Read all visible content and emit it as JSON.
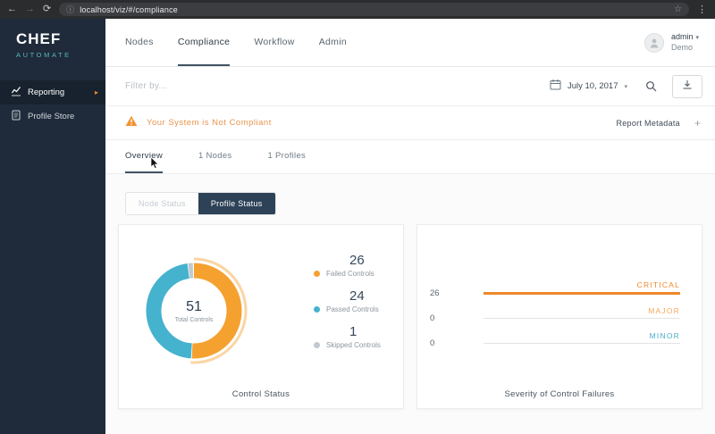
{
  "browser": {
    "url": "localhost/viz/#/compliance",
    "back_icon": "←",
    "forward_icon": "→",
    "reload_icon": "⟳",
    "info_icon": "ⓘ",
    "star_icon": "☆",
    "menu_icon": "⋮"
  },
  "sidebar": {
    "logo": {
      "line1": "CHEF",
      "line2": "AUTOMATE"
    },
    "active_arrow": "▸",
    "items": [
      {
        "label": "Reporting",
        "active": true
      },
      {
        "label": "Profile Store",
        "active": false
      }
    ]
  },
  "topnav": {
    "items": [
      {
        "label": "Nodes",
        "active": false
      },
      {
        "label": "Compliance",
        "active": true
      },
      {
        "label": "Workflow",
        "active": false
      },
      {
        "label": "Admin",
        "active": false
      }
    ],
    "user": {
      "name": "admin",
      "org": "Demo",
      "caret": "▾"
    }
  },
  "filter_bar": {
    "placeholder": "Filter by...",
    "date": "July 10, 2017",
    "caret": "▾"
  },
  "banner": {
    "message": "Your System is Not Compliant",
    "metadata_label": "Report Metadata",
    "metadata_action": "+"
  },
  "tabs": [
    {
      "label": "Overview",
      "active": true
    },
    {
      "label": "1 Nodes",
      "active": false
    },
    {
      "label": "1 Profiles",
      "active": false
    }
  ],
  "status_toggle": [
    {
      "label": "Node Status",
      "active": false
    },
    {
      "label": "Profile Status",
      "active": true
    }
  ],
  "chart_data": [
    {
      "type": "pie",
      "title": "Control Status",
      "center_value": "51",
      "center_label": "Total Controls",
      "segments": [
        {
          "name": "Failed Controls",
          "value": 26,
          "color": "#f5a130"
        },
        {
          "name": "Passed Controls",
          "value": 24,
          "color": "#45b2ce"
        },
        {
          "name": "Skipped Controls",
          "value": 1,
          "color": "#c3c9ce"
        }
      ]
    },
    {
      "type": "bar",
      "orientation": "horizontal",
      "title": "Severity of Control Failures",
      "categories": [
        "CRITICAL",
        "MAJOR",
        "MINOR"
      ],
      "values": [
        26,
        0,
        0
      ],
      "colors": [
        "#f0882a",
        "#f5a85c",
        "#49aec9"
      ]
    }
  ],
  "colors": {
    "sidebar_bg": "#1f2b3a",
    "accent_orange": "#f18b21",
    "accent_teal": "#45b2ce",
    "navy": "#2d4257",
    "warning_text": "#e8954e"
  }
}
